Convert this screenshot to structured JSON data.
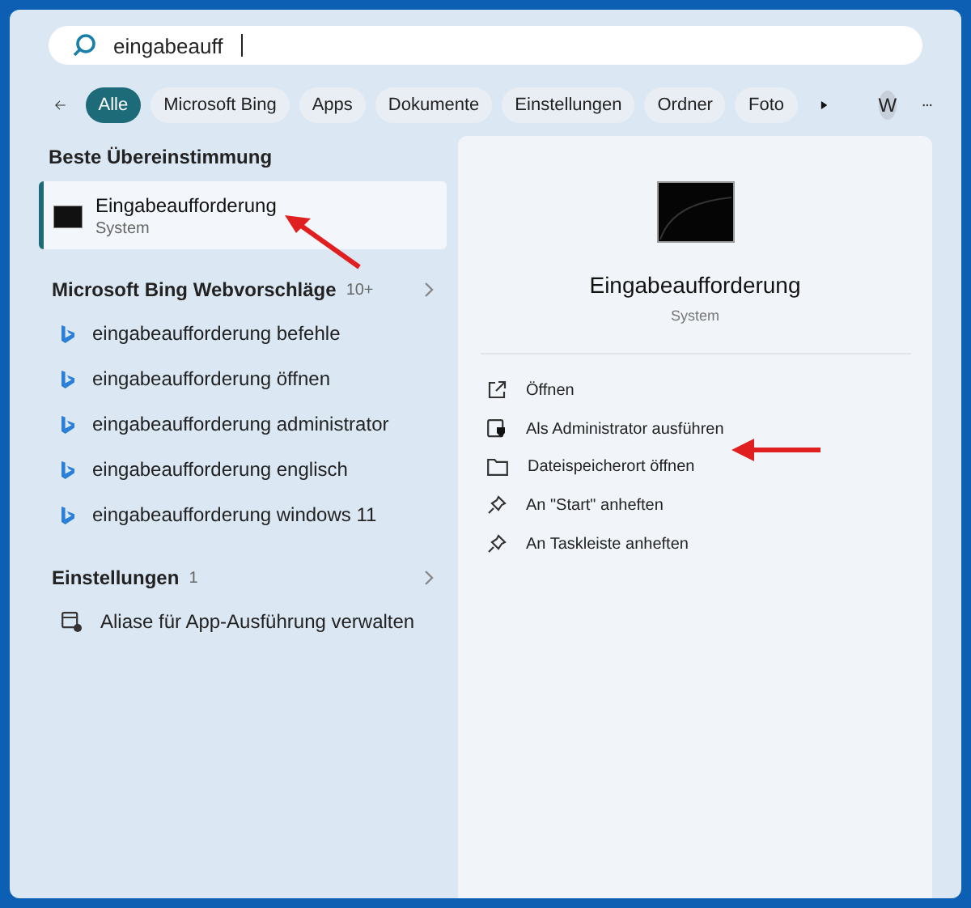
{
  "search": {
    "value": "eingabeauff"
  },
  "filters": [
    {
      "label": "Alle",
      "selected": true
    },
    {
      "label": "Microsoft Bing",
      "selected": false
    },
    {
      "label": "Apps",
      "selected": false
    },
    {
      "label": "Dokumente",
      "selected": false
    },
    {
      "label": "Einstellungen",
      "selected": false
    },
    {
      "label": "Ordner",
      "selected": false
    },
    {
      "label": "Foto",
      "selected": false
    }
  ],
  "account": {
    "initial": "W"
  },
  "best_match": {
    "title": "Beste Übereinstimmung",
    "item": {
      "name": "Eingabeaufforderung",
      "subtitle": "System",
      "selected": true
    }
  },
  "sections": [
    {
      "title": "Microsoft Bing Webvorschläge",
      "count": "10+",
      "items": [
        {
          "kind": "web",
          "label": "eingabeaufforderung befehle"
        },
        {
          "kind": "web",
          "label": "eingabeaufforderung öffnen"
        },
        {
          "kind": "web",
          "label": "eingabeaufforderung administrator"
        },
        {
          "kind": "web",
          "label": "eingabeaufforderung englisch"
        },
        {
          "kind": "web",
          "label": "eingabeaufforderung windows 11"
        }
      ]
    },
    {
      "title": "Einstellungen",
      "count": "1",
      "items": [
        {
          "kind": "setting",
          "label": "Aliase für App-Ausführung verwalten"
        }
      ]
    }
  ],
  "detail": {
    "title": "Eingabeaufforderung",
    "subtitle": "System",
    "actions": [
      {
        "kind": "open",
        "label": "Öffnen"
      },
      {
        "kind": "admin",
        "label": "Als Administrator ausführen"
      },
      {
        "kind": "folder",
        "label": "Dateispeicherort öffnen"
      },
      {
        "kind": "pin",
        "label": "An \"Start\" anheften"
      },
      {
        "kind": "pin",
        "label": "An Taskleiste anheften"
      }
    ]
  }
}
